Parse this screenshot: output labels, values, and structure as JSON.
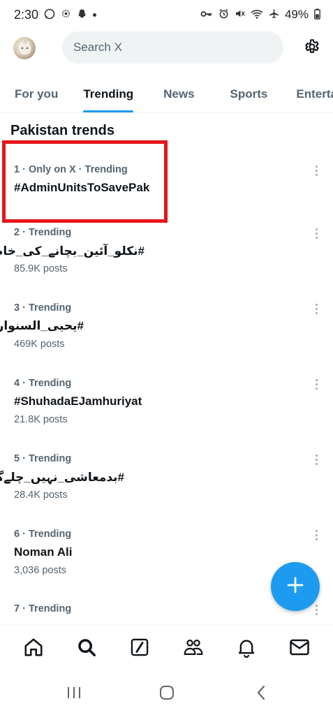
{
  "status_bar": {
    "time": "2:30",
    "battery": "49%"
  },
  "search": {
    "placeholder": "Search X"
  },
  "tabs": [
    {
      "label": "For you"
    },
    {
      "label": "Trending"
    },
    {
      "label": "News"
    },
    {
      "label": "Sports"
    },
    {
      "label": "Entertainment"
    }
  ],
  "section_title": "Pakistan trends",
  "trends": [
    {
      "meta": "1 · Only on X · Trending",
      "name": "#AdminUnitsToSavePak",
      "posts": ""
    },
    {
      "meta": "2 · Trending",
      "name": "#نکلو_آئین_بچانے_کی_خاطر",
      "posts": "85.9K posts"
    },
    {
      "meta": "3 · Trending",
      "name": "#یحیی_السنوار",
      "posts": "469K posts"
    },
    {
      "meta": "4 · Trending",
      "name": "#ShuhadaEJamhuriyat",
      "posts": "21.8K posts"
    },
    {
      "meta": "5 · Trending",
      "name": "#بدمعاشی_نہیں_چلےگی",
      "posts": "28.4K posts"
    },
    {
      "meta": "6 · Trending",
      "name": "Noman Ali",
      "posts": "3,036 posts"
    },
    {
      "meta": "7 · Trending",
      "name": "",
      "posts": ""
    }
  ],
  "colors": {
    "accent": "#1d9bf0",
    "highlight": "#e5161b"
  },
  "bottom_nav": [
    "home-icon",
    "search-icon",
    "grok-icon",
    "communities-icon",
    "notifications-icon",
    "messages-icon"
  ]
}
